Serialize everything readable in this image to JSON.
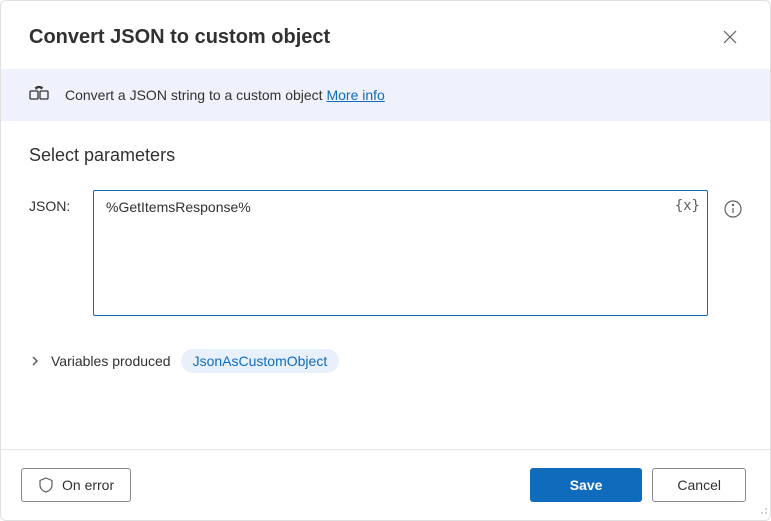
{
  "header": {
    "title": "Convert JSON to custom object"
  },
  "info": {
    "description": "Convert a JSON string to a custom object ",
    "more_info_label": "More info"
  },
  "section": {
    "title": "Select parameters"
  },
  "form": {
    "json_label": "JSON:",
    "json_value": "%GetItemsResponse%",
    "variable_token": "{x}"
  },
  "variables": {
    "label": "Variables produced",
    "produced": "JsonAsCustomObject"
  },
  "footer": {
    "on_error_label": "On error",
    "save_label": "Save",
    "cancel_label": "Cancel"
  }
}
